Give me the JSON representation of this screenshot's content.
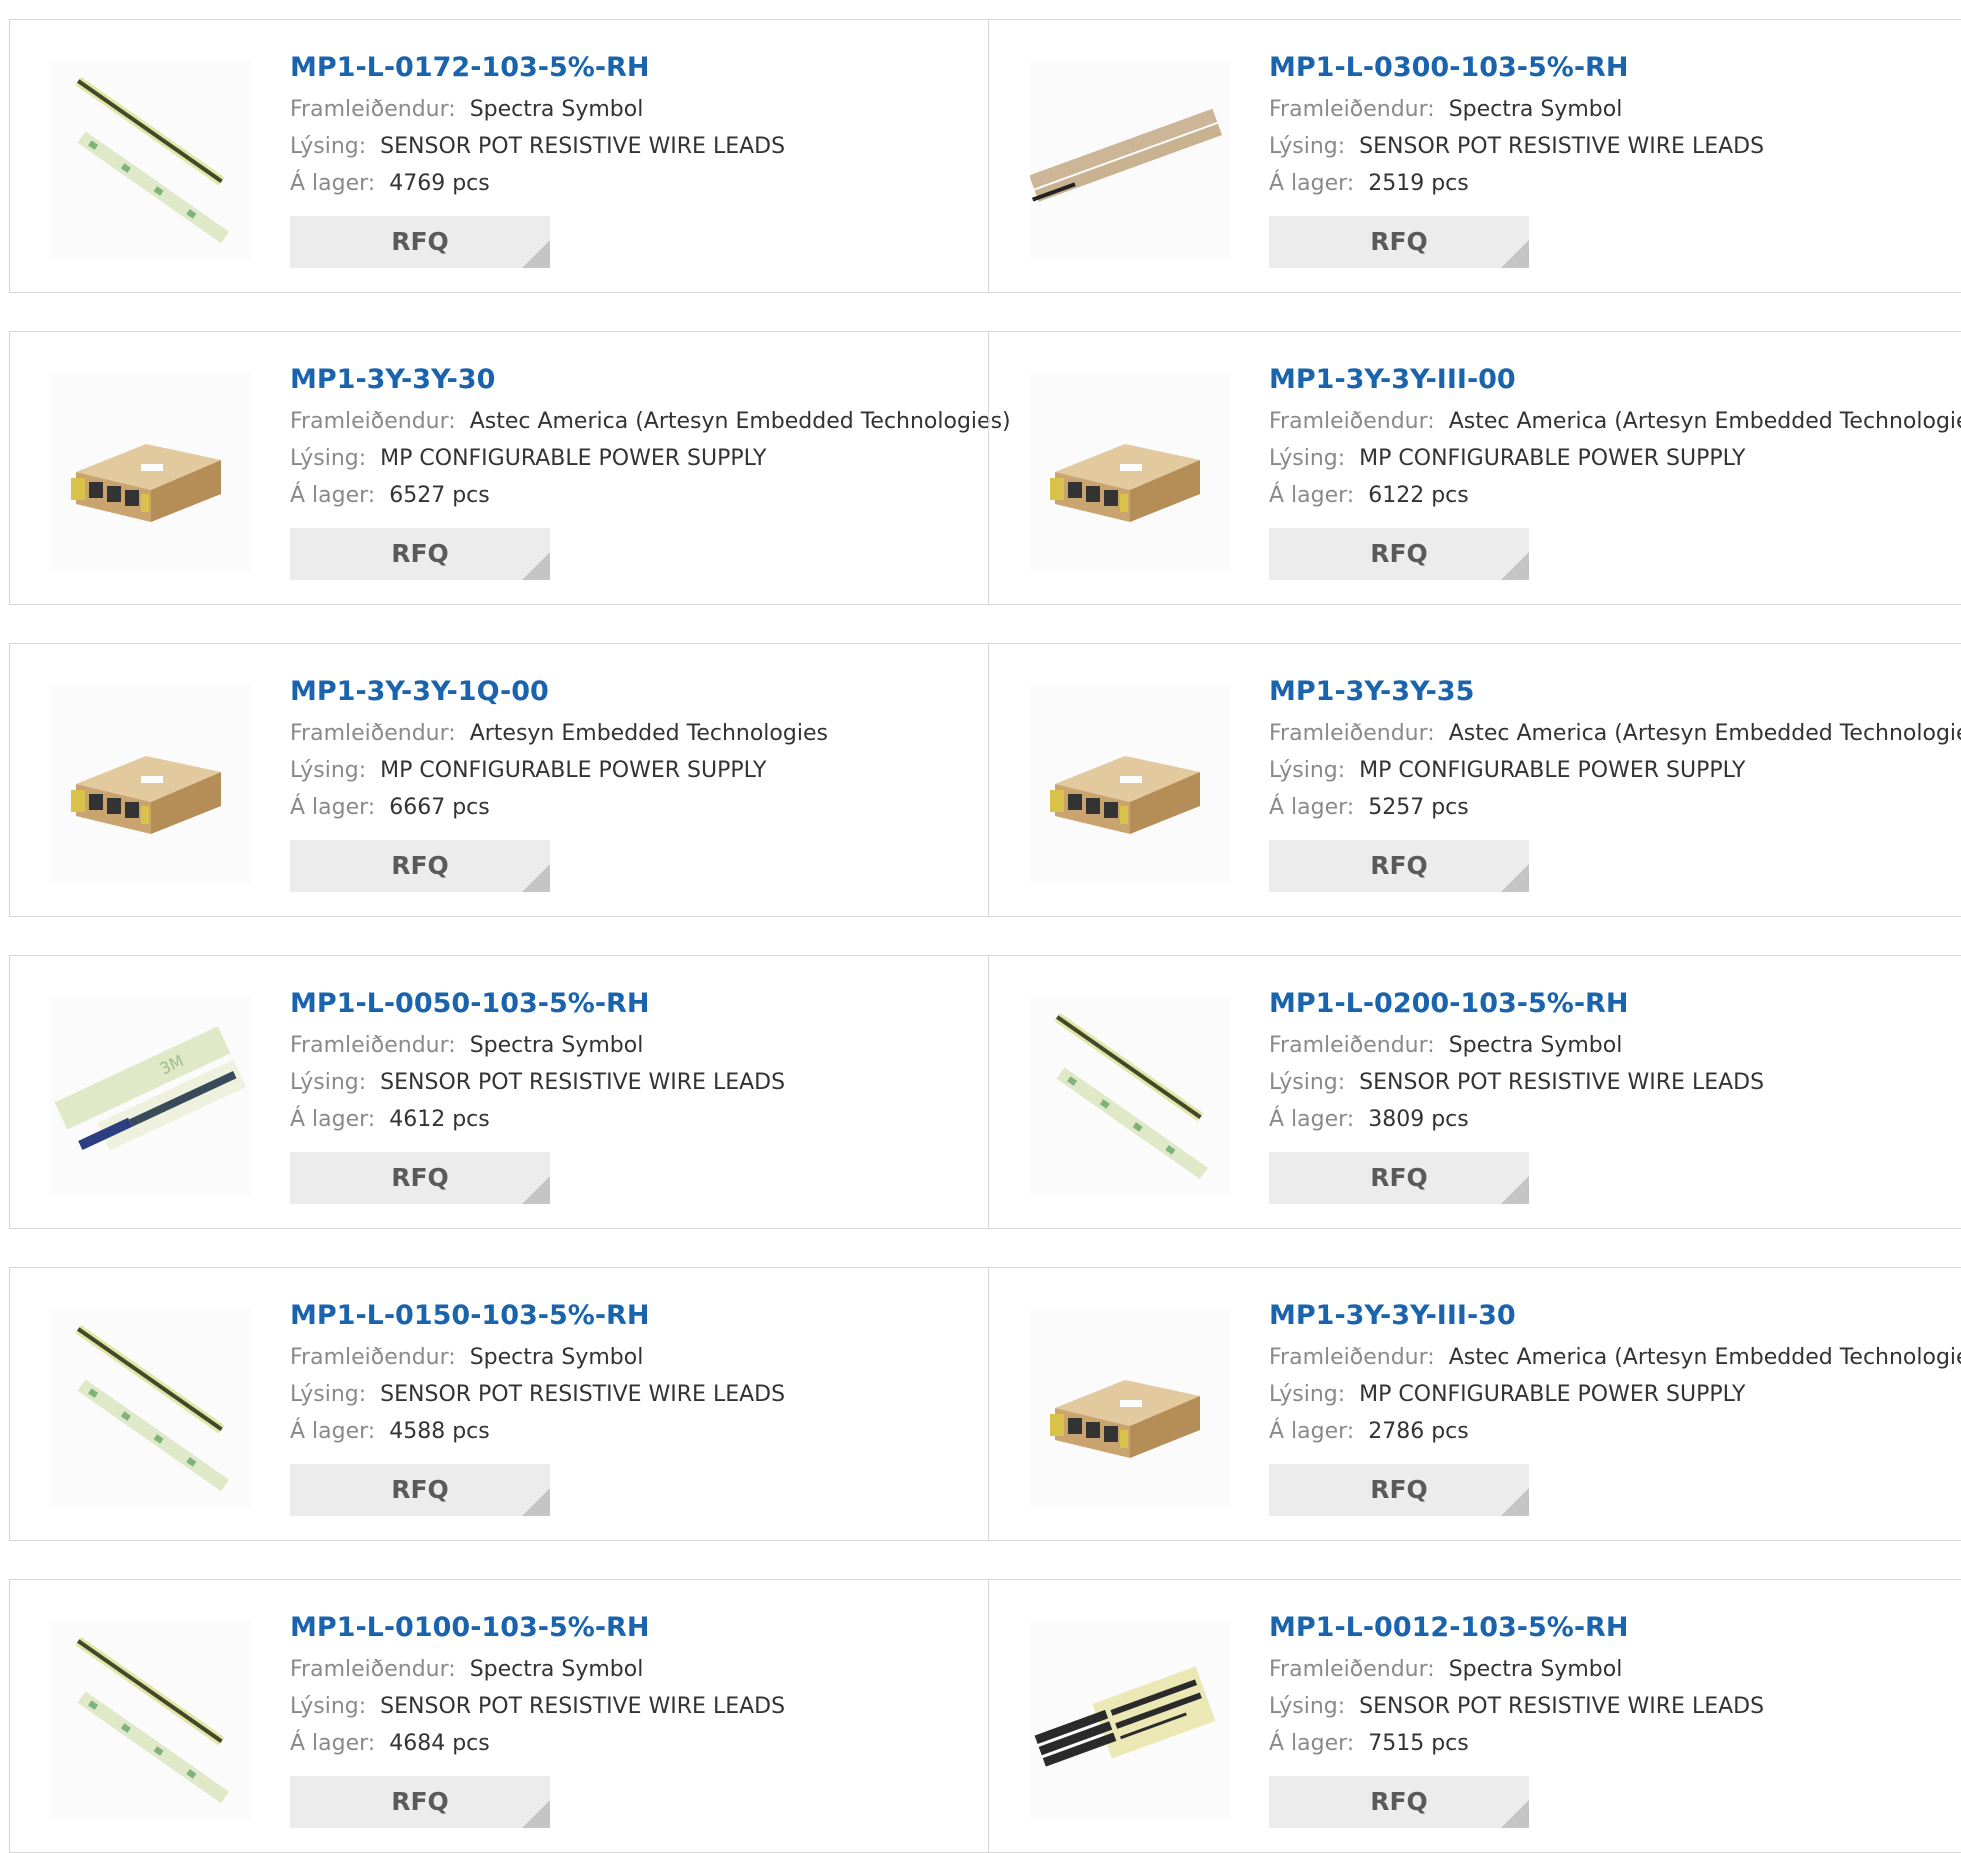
{
  "labels": {
    "manufacturer": "Framleiðendur:",
    "description": "Lýsing:",
    "stock": "Á lager:",
    "rfq": "RFQ"
  },
  "colors": {
    "title_link": "#1a63ad",
    "label_gray": "#8a8a8a",
    "rfq_bg": "#ececec",
    "border": "#d6d6d6"
  },
  "products": [
    {
      "part": "MP1-L-0172-103-5%-RH",
      "manufacturer": "Spectra Symbol",
      "description": "SENSOR POT RESISTIVE WIRE LEADS",
      "stock": "4769 pcs",
      "image": "strip-sensor-image"
    },
    {
      "part": "MP1-L-0300-103-5%-RH",
      "manufacturer": "Spectra Symbol",
      "description": "SENSOR POT RESISTIVE WIRE LEADS",
      "stock": "2519 pcs",
      "image": "tan-strip-sensor-image"
    },
    {
      "part": "MP1-3Y-3Y-30",
      "manufacturer": "Astec America (Artesyn Embedded Technologies)",
      "description": "MP CONFIGURABLE POWER SUPPLY",
      "stock": "6527 pcs",
      "image": "power-supply-image"
    },
    {
      "part": "MP1-3Y-3Y-III-00",
      "manufacturer": "Astec America (Artesyn Embedded Technologies)",
      "description": "MP CONFIGURABLE POWER SUPPLY",
      "stock": "6122 pcs",
      "image": "power-supply-image"
    },
    {
      "part": "MP1-3Y-3Y-1Q-00",
      "manufacturer": "Artesyn Embedded Technologies",
      "description": "MP CONFIGURABLE POWER SUPPLY",
      "stock": "6667 pcs",
      "image": "power-supply-image"
    },
    {
      "part": "MP1-3Y-3Y-35",
      "manufacturer": "Astec America (Artesyn Embedded Technologies)",
      "description": "MP CONFIGURABLE POWER SUPPLY",
      "stock": "5257 pcs",
      "image": "power-supply-image"
    },
    {
      "part": "MP1-L-0050-103-5%-RH",
      "manufacturer": "Spectra Symbol",
      "description": "SENSOR POT RESISTIVE WIRE LEADS",
      "stock": "4612 pcs",
      "image": "short-strip-sensor-image"
    },
    {
      "part": "MP1-L-0200-103-5%-RH",
      "manufacturer": "Spectra Symbol",
      "description": "SENSOR POT RESISTIVE WIRE LEADS",
      "stock": "3809 pcs",
      "image": "strip-sensor-image"
    },
    {
      "part": "MP1-L-0150-103-5%-RH",
      "manufacturer": "Spectra Symbol",
      "description": "SENSOR POT RESISTIVE WIRE LEADS",
      "stock": "4588 pcs",
      "image": "strip-sensor-image"
    },
    {
      "part": "MP1-3Y-3Y-III-30",
      "manufacturer": "Astec America (Artesyn Embedded Technologies)",
      "description": "MP CONFIGURABLE POWER SUPPLY",
      "stock": "2786 pcs",
      "image": "power-supply-image"
    },
    {
      "part": "MP1-L-0100-103-5%-RH",
      "manufacturer": "Spectra Symbol",
      "description": "SENSOR POT RESISTIVE WIRE LEADS",
      "stock": "4684 pcs",
      "image": "strip-sensor-image"
    },
    {
      "part": "MP1-L-0012-103-5%-RH",
      "manufacturer": "Spectra Symbol",
      "description": "SENSOR POT RESISTIVE WIRE LEADS",
      "stock": "7515 pcs",
      "image": "pcb-sensor-image"
    }
  ]
}
